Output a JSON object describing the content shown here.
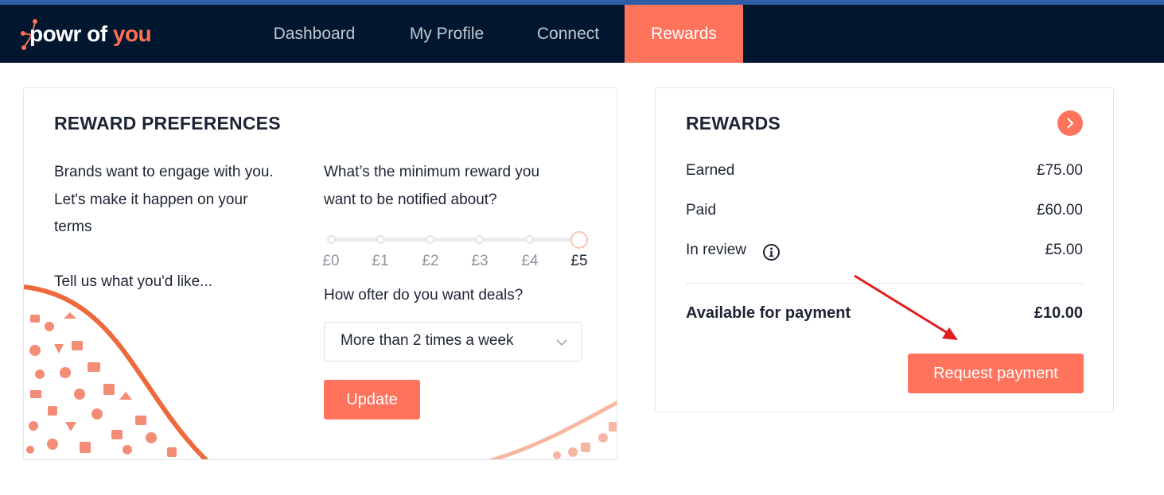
{
  "nav": {
    "logo_word1": "powr of",
    "logo_word2": "you",
    "items": [
      {
        "label": "Dashboard",
        "active": false
      },
      {
        "label": "My Profile",
        "active": false
      },
      {
        "label": "Connect",
        "active": false
      },
      {
        "label": "Rewards",
        "active": true
      }
    ]
  },
  "preferences": {
    "title": "REWARD PREFERENCES",
    "intro": [
      "Brands want to engage with you.",
      "Let's make it happen on your",
      "terms"
    ],
    "prompt": "Tell us what you'd like...",
    "min_reward_question": [
      "What’s the minimum reward you",
      "want to be notified about?"
    ],
    "ticks": [
      "£0",
      "£1",
      "£2",
      "£3",
      "£4",
      "£5"
    ],
    "selected_tick": "£5",
    "frequency_question": "How ofter do you want deals?",
    "frequency_value": "More than 2 times a week",
    "update_label": "Update"
  },
  "rewards": {
    "title": "REWARDS",
    "rows": [
      {
        "label": "Earned",
        "value": "£75.00"
      },
      {
        "label": "Paid",
        "value": "£60.00"
      },
      {
        "label": "In review",
        "value": "£5.00"
      }
    ],
    "available_label": "Available for payment",
    "available_value": "£10.00",
    "request_label": "Request payment"
  },
  "colors": {
    "accent": "#ff735c",
    "navbar": "#00172f",
    "annotation_arrow": "#e11d1d"
  }
}
